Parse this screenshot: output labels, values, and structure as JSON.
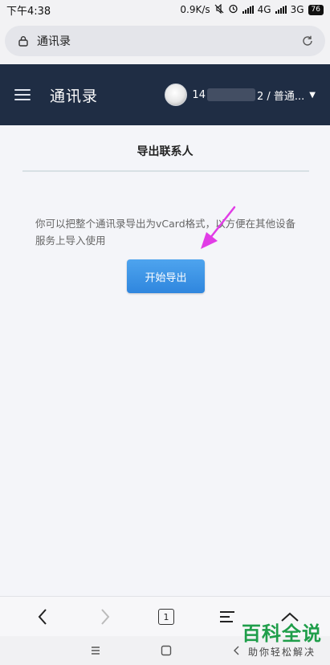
{
  "status_bar": {
    "time": "下午4:38",
    "speed": "0.9K/s",
    "network1": "4G",
    "network2": "3G",
    "battery": "76"
  },
  "url_bar": {
    "title": "通讯录"
  },
  "header": {
    "title": "通讯录",
    "user_prefix": "14",
    "user_suffix": "2 / 普通..."
  },
  "content": {
    "section_title": "导出联系人",
    "description": "你可以把整个通讯录导出为vCard格式，以方便在其他设备服务上导入使用",
    "export_button": "开始导出"
  },
  "browser_nav": {
    "tab_count": "1"
  },
  "watermark": {
    "main": "百科全说",
    "sub": "助你轻松解决"
  },
  "colors": {
    "header_bg": "#1f2d44",
    "button": "#3a92e6",
    "annotation_arrow": "#e13ce6",
    "watermark": "#1f9e4a"
  }
}
